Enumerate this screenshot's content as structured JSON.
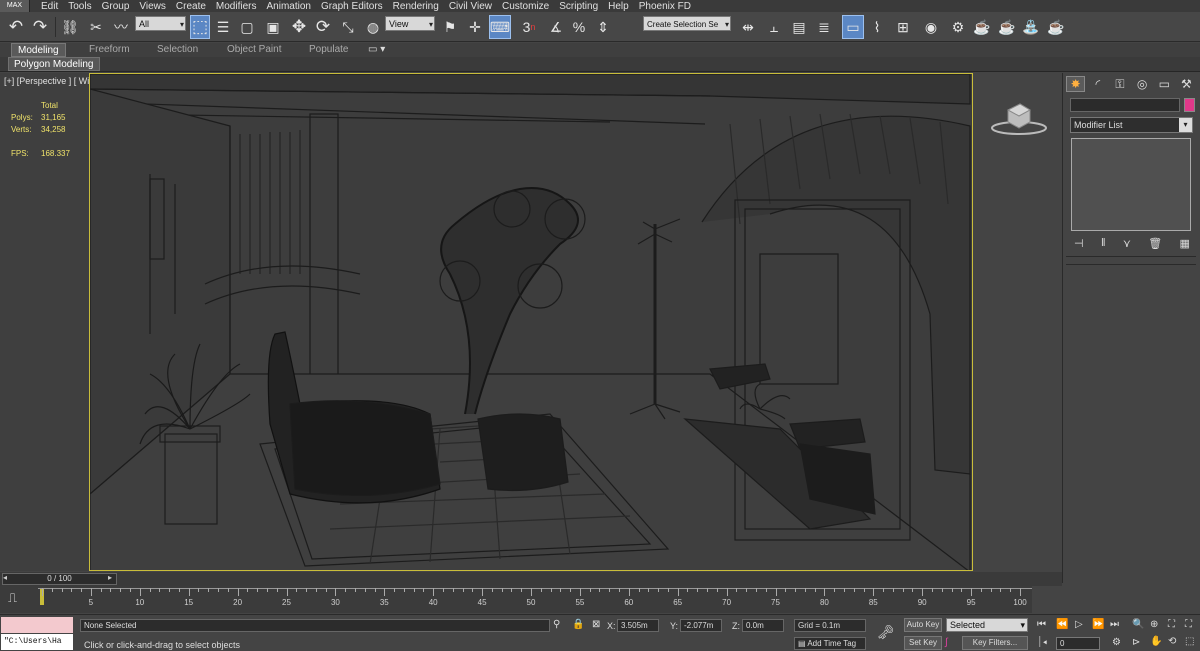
{
  "app": {
    "logo": "MAX"
  },
  "menu": [
    "Edit",
    "Tools",
    "Group",
    "Views",
    "Create",
    "Modifiers",
    "Animation",
    "Graph Editors",
    "Rendering",
    "Civil View",
    "Customize",
    "Scripting",
    "Help",
    "Phoenix FD"
  ],
  "toolbar": {
    "selection_filter": "All",
    "reference_coord": "View",
    "named_selection_placeholder": "Create Selection Se",
    "snap_label": "3"
  },
  "ribbon": {
    "tabs": [
      "Modeling",
      "Freeform",
      "Selection",
      "Object Paint",
      "Populate"
    ],
    "active_tab": "Modeling",
    "sub_tab": "Polygon Modeling"
  },
  "viewport": {
    "label": "[+] [Perspective ] [ Wireframe ]  <<Disabled>>",
    "stats": {
      "header": "Total",
      "polys_label": "Polys:",
      "polys": "31,165",
      "verts_label": "Verts:",
      "verts": "34,258",
      "fps_label": "FPS:",
      "fps": "168.337"
    }
  },
  "command_panel": {
    "modifier_list": "Modifier List",
    "color_swatch": "#e0388a"
  },
  "timeline": {
    "frame_range": "0 / 100",
    "ticks": [
      "5",
      "10",
      "15",
      "20",
      "25",
      "30",
      "35",
      "40",
      "45",
      "50",
      "55",
      "60",
      "65",
      "70",
      "75",
      "80",
      "85",
      "90",
      "95",
      "100"
    ]
  },
  "status": {
    "maxscript_value": "\"C:\\Users\\Ha",
    "selection_text": "None Selected",
    "prompt_text": "Click or click-and-drag to select objects",
    "x_label": "X:",
    "x_value": "3.505m",
    "y_label": "Y:",
    "y_value": "-2.077m",
    "z_label": "Z:",
    "z_value": "0.0m",
    "grid": "Grid = 0.1m",
    "add_time_tag": "Add Time Tag",
    "auto_key": "Auto Key",
    "set_key": "Set Key",
    "key_mode": "Selected",
    "key_filters": "Key Filters...",
    "current_frame": "0"
  }
}
